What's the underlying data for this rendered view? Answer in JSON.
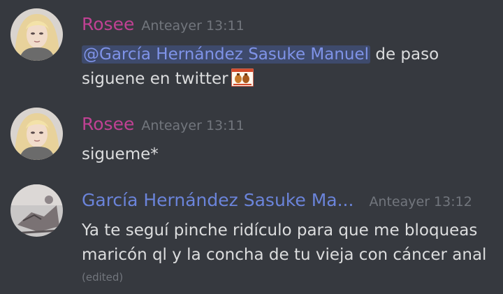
{
  "colors": {
    "background": "#36393f",
    "rosee_name": "#c04193",
    "garcia_name": "#6b84da",
    "mention_bg": "#3e4a6c",
    "mention_text": "#7f93e8",
    "message_text": "#dcddde",
    "timestamp": "#72767d"
  },
  "messages": [
    {
      "author": "Rosee",
      "timestamp": "Anteayer 13:11",
      "avatar_icon": "user-avatar-blonde",
      "mention": "@García Hernández Sasuke Manuel",
      "line1_rest": "de paso",
      "line2": "siguene en twitter",
      "emoji_icon": "custom-emoji-jars"
    },
    {
      "author": "Rosee",
      "timestamp": "Anteayer 13:11",
      "avatar_icon": "user-avatar-blonde",
      "line1": "sigueme*"
    },
    {
      "author": "García Hernández Sasuke Ma...",
      "timestamp": "Anteayer 13:12",
      "avatar_icon": "user-avatar-sketch",
      "line1": "Ya te seguí pinche ridículo para que me bloqueas",
      "line2": "maricón ql y la concha de tu vieja con cáncer anal",
      "edited": "(edited)"
    }
  ]
}
